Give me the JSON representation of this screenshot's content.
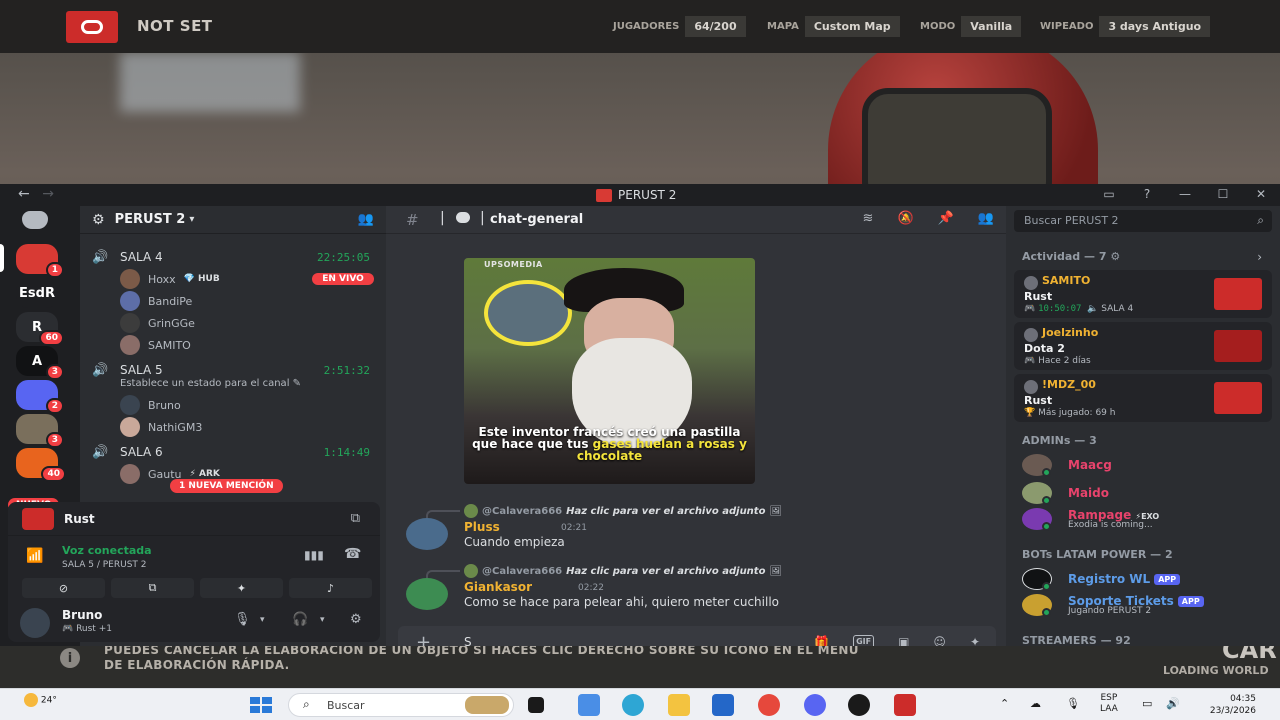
{
  "game": {
    "server_name": "NOT SET",
    "stats": [
      {
        "label": "JUGADORES",
        "value": "64/200"
      },
      {
        "label": "MAPA",
        "value": "Custom Map"
      },
      {
        "label": "MODO",
        "value": "Vanilla"
      },
      {
        "label": "WIPEADO",
        "value": "3 days Antiguo"
      }
    ],
    "hint_icon": "i",
    "hint": "PUEDES CANCELAR LA ELABORACIÓN DE UN OBJETO SI HACES CLIC DERECHO SOBRE SU ÍCONO EN EL MENÚ DE ELABORACIÓN RÁPIDA.",
    "corner_big": "CAR",
    "loading": "LOADING WORLD"
  },
  "window": {
    "title": "PERUST 2",
    "back": "←",
    "forward": "→",
    "controls": [
      "▭",
      "?",
      "—",
      "☐",
      "✕"
    ]
  },
  "rail": {
    "items": [
      {
        "label": "",
        "badge": "1",
        "color": "#d83a34"
      },
      {
        "label": "EsdR",
        "badge": "",
        "color": "#1e1f22"
      },
      {
        "label": "R",
        "badge": "60",
        "color": "#2b2d31"
      },
      {
        "label": "A",
        "badge": "3",
        "color": "#111214"
      },
      {
        "label": "",
        "badge": "2",
        "color": "#5865f2"
      },
      {
        "label": "",
        "badge": "3",
        "color": "#7a6f5c"
      },
      {
        "label": "",
        "badge": "40",
        "color": "#e8641e"
      }
    ],
    "nuevo": "NUEVO"
  },
  "sidebar": {
    "guild_name": "PERUST 2",
    "channels": [
      {
        "name": "SALA 4",
        "time": "22:25:05"
      },
      {
        "name": "SALA 5",
        "time": "2:51:32",
        "status": "Establece un estado para el canal ✎"
      },
      {
        "name": "SALA 6",
        "time": "1:14:49"
      }
    ],
    "sala4_members": [
      "Hoxx",
      "BandiPe",
      "GrinGGe",
      "SAMITO"
    ],
    "hoxx_tag": "💎 HUB",
    "live": "EN VIVO",
    "sala5_members": [
      "Bruno",
      "NathiGM3"
    ],
    "sala6_members": [
      "Gautu"
    ],
    "gautu_tag": "⚡ ARK",
    "mention": "1 NUEVA MENCIÓN"
  },
  "voice_panel": {
    "activity": "Rust",
    "connected": "Voz conectada",
    "location": "SALA 5 / PERUST 2",
    "username": "Bruno",
    "user_status": "🎮 Rust +1"
  },
  "chat": {
    "channel": "chat-general",
    "media": {
      "brand": "UPSOMEDIA",
      "caption_1": "Este inventor francés creó una pastilla que hace que tus ",
      "caption_hl": "gases huelan a rosas y chocolate"
    },
    "messages": [
      {
        "reply_author": "@Calavera666",
        "reply_text": "Haz clic para ver el archivo adjunto",
        "author": "Pluss",
        "author_color": "#f0b232",
        "time": "02:21",
        "text": "Cuando empieza"
      },
      {
        "reply_author": "@Calavera666",
        "reply_text": "Haz clic para ver el archivo adjunto",
        "author": "Giankasor",
        "author_color": "#f0b232",
        "time": "02:22",
        "text": "Como se hace para pelear ahi, quiero meter cuchillo"
      }
    ],
    "composer_value": "S",
    "gif_label": "GIF"
  },
  "right": {
    "search_placeholder": "Buscar PERUST 2",
    "activity_title": "Actividad — 7 ⚙",
    "activities": [
      {
        "user": "SAMITO",
        "game": "Rust",
        "time": "10:50:07",
        "extra": "🔈 SALA 4",
        "thumb": "#cc2c2a"
      },
      {
        "user": "Joelzinho",
        "game": "Dota 2",
        "meta": "🎮 Hace 2 días",
        "thumb": "#a51e1e"
      },
      {
        "user": "!MDZ_00",
        "game": "Rust",
        "meta": "🏆 Más jugado: 69 h",
        "thumb": "#cc2c2a"
      }
    ],
    "admins_title": "ADMINs — 3",
    "admins": [
      {
        "name": "Maacg",
        "color": "#e8436c"
      },
      {
        "name": "Maido",
        "color": "#e8436c"
      },
      {
        "name": "Rampage",
        "color": "#e8436c",
        "tag": "⚡EXO",
        "sub": "Exodia is coming..."
      }
    ],
    "bots_title": "BOTs LATAM POWER — 2",
    "bots": [
      {
        "name": "Registro WL",
        "color": "#5d9ce8",
        "app": "APP"
      },
      {
        "name": "Soporte Tickets",
        "color": "#5d9ce8",
        "app": "APP",
        "sub": "Jugando PERUST 2"
      }
    ],
    "streamers_title": "STREAMERS — 92"
  },
  "taskbar": {
    "temp": "24°",
    "search": "Buscar",
    "lang_1": "ESP",
    "lang_2": "LAA",
    "time": "04:35",
    "date": "23/3/2026"
  }
}
